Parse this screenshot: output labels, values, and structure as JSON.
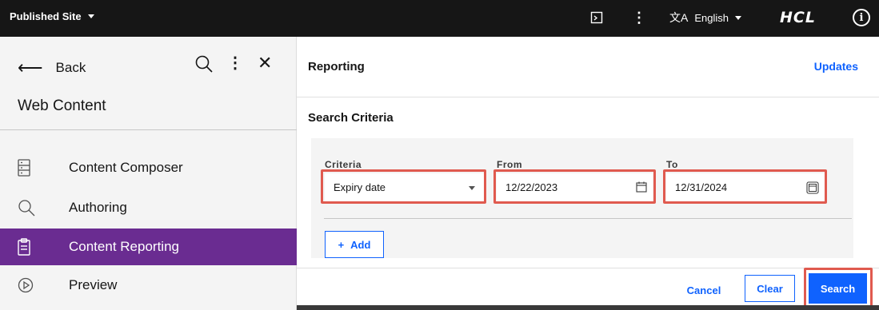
{
  "topbar": {
    "site_label": "Published Site",
    "language": "English",
    "logo": "HCL",
    "icons": [
      "panel-icon",
      "overflow-menu-icon",
      "translate-icon",
      "info-icon"
    ]
  },
  "sidebar": {
    "back_label": "Back",
    "title": "Web Content",
    "items": [
      {
        "label": "Content Composer",
        "icon": "composer-icon",
        "active": false
      },
      {
        "label": "Authoring",
        "icon": "search-icon",
        "active": false
      },
      {
        "label": "Content Reporting",
        "icon": "clipboard-icon",
        "active": true
      },
      {
        "label": "Preview",
        "icon": "play-icon",
        "active": false
      }
    ],
    "active_color": "#6a2c91"
  },
  "main": {
    "title": "Reporting",
    "updates_link": "Updates",
    "section_title": "Search Criteria",
    "fields": {
      "criteria_label": "Criteria",
      "criteria_value": "Expiry date",
      "from_label": "From",
      "from_value": "12/22/2023",
      "to_label": "To",
      "to_value": "12/31/2024"
    },
    "add_label": "Add",
    "cancel_label": "Cancel",
    "clear_label": "Clear",
    "search_label": "Search",
    "accent_color": "#0f62fe",
    "highlight_color": "#e05a4f"
  }
}
